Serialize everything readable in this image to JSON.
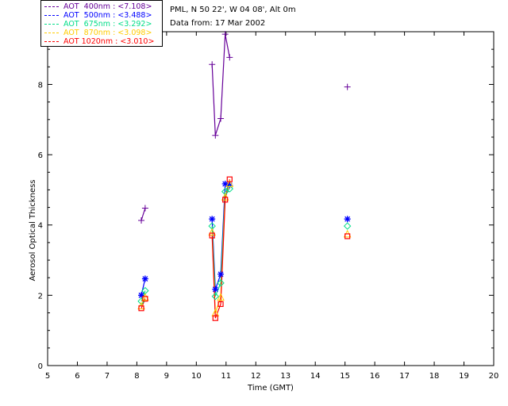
{
  "info": {
    "location": "PML, N 50 22', W 04 08', Alt 0m",
    "date": "Data from: 17 Mar 2002"
  },
  "chart_data": {
    "type": "line",
    "xlabel": "Time (GMT)",
    "ylabel": "Aerosol Optical Thickness",
    "xlim": [
      5,
      20
    ],
    "ylim": [
      0,
      9.5
    ],
    "xticks": [
      "5",
      "6",
      "7",
      "8",
      "9",
      "10",
      "11",
      "12",
      "13",
      "14",
      "15",
      "16",
      "17",
      "18",
      "19",
      "20"
    ],
    "yticks": [
      "0",
      "2",
      "4",
      "6",
      "8"
    ],
    "grid": false,
    "legend_position": "top-left",
    "series": [
      {
        "name": "AOT  400nm : <7.108>",
        "color": "#660099",
        "marker": "plus",
        "segments": [
          [
            [
              8.15,
              4.13
            ],
            [
              8.28,
              4.48
            ]
          ],
          [
            [
              10.53,
              8.57
            ],
            [
              10.64,
              6.55
            ],
            [
              10.82,
              7.03
            ],
            [
              10.97,
              9.43
            ],
            [
              11.12,
              8.77
            ]
          ],
          [
            [
              15.08,
              7.93
            ]
          ]
        ]
      },
      {
        "name": "AOT  500nm : <3.488>",
        "color": "#0000ff",
        "marker": "asterisk",
        "segments": [
          [
            [
              8.15,
              2.0
            ],
            [
              8.28,
              2.47
            ]
          ],
          [
            [
              10.53,
              4.17
            ],
            [
              10.64,
              2.17
            ],
            [
              10.82,
              2.6
            ],
            [
              10.97,
              5.17
            ],
            [
              11.12,
              5.13
            ]
          ],
          [
            [
              15.08,
              4.17
            ]
          ]
        ]
      },
      {
        "name": "AOT  675nm : <3.292>",
        "color": "#00dd88",
        "marker": "diamond",
        "segments": [
          [
            [
              8.15,
              1.83
            ],
            [
              8.28,
              2.13
            ]
          ],
          [
            [
              10.53,
              3.97
            ],
            [
              10.64,
              1.97
            ],
            [
              10.82,
              2.35
            ],
            [
              10.97,
              4.95
            ],
            [
              11.12,
              5.03
            ]
          ],
          [
            [
              15.08,
              3.97
            ]
          ]
        ]
      },
      {
        "name": "AOT  870nm : <3.098>",
        "color": "#ffcc00",
        "marker": "triangle",
        "segments": [
          [
            [
              8.15,
              1.7
            ],
            [
              8.28,
              1.95
            ]
          ],
          [
            [
              10.53,
              3.8
            ],
            [
              10.64,
              1.5
            ],
            [
              10.82,
              1.95
            ],
            [
              10.97,
              4.8
            ],
            [
              11.12,
              5.18
            ]
          ],
          [
            [
              15.08,
              3.75
            ]
          ]
        ]
      },
      {
        "name": "AOT 1020nm : <3.010>",
        "color": "#ff0000",
        "marker": "square",
        "segments": [
          [
            [
              8.15,
              1.63
            ],
            [
              8.28,
              1.9
            ]
          ],
          [
            [
              10.53,
              3.7
            ],
            [
              10.64,
              1.35
            ],
            [
              10.82,
              1.75
            ],
            [
              10.97,
              4.72
            ],
            [
              11.12,
              5.3
            ]
          ],
          [
            [
              15.08,
              3.68
            ]
          ]
        ]
      }
    ]
  }
}
